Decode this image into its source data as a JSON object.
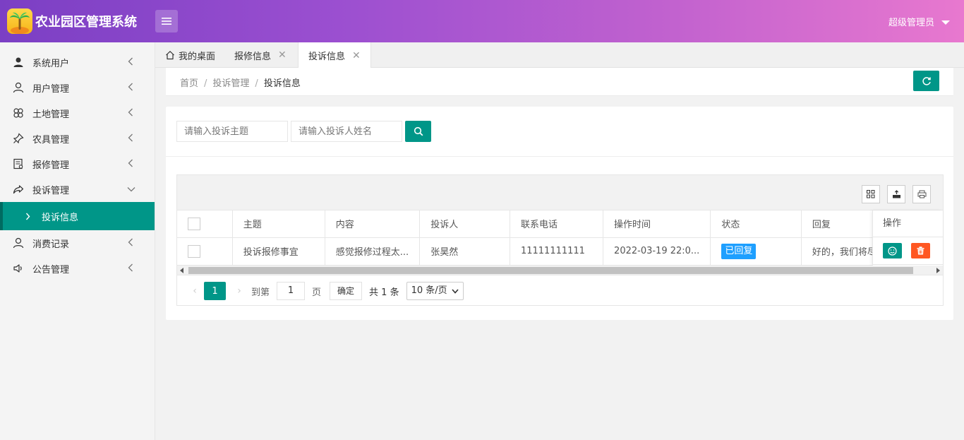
{
  "header": {
    "app_title": "农业园区管理系统",
    "user_name": "超级管理员"
  },
  "sidebar": {
    "items": [
      {
        "label": "系统用户",
        "icon": "user-filled-icon"
      },
      {
        "label": "用户管理",
        "icon": "user-outline-icon"
      },
      {
        "label": "土地管理",
        "icon": "clover-icon"
      },
      {
        "label": "农具管理",
        "icon": "pin-icon"
      },
      {
        "label": "报修管理",
        "icon": "form-icon"
      },
      {
        "label": "投诉管理",
        "icon": "share-icon"
      },
      {
        "label": "消费记录",
        "icon": "user-outline-icon"
      },
      {
        "label": "公告管理",
        "icon": "speaker-icon"
      }
    ],
    "sub_active": "投诉信息"
  },
  "tabs": [
    {
      "label": "我的桌面",
      "icon": "home-icon"
    },
    {
      "label": "报修信息"
    },
    {
      "label": "投诉信息",
      "active": true
    }
  ],
  "breadcrumb": {
    "home": "首页",
    "section": "投诉管理",
    "current": "投诉信息",
    "sep": "/"
  },
  "search": {
    "subject_placeholder": "请输入投诉主题",
    "name_placeholder": "请输入投诉人姓名"
  },
  "table": {
    "columns": [
      "主题",
      "内容",
      "投诉人",
      "联系电话",
      "操作时间",
      "状态",
      "回复"
    ],
    "op_column": "操作",
    "rows": [
      {
        "subject": "投诉报修事宜",
        "content": "感觉报修过程太...",
        "person": "张昊然",
        "phone": "11111111111",
        "time": "2022-03-19 22:0...",
        "status": "已回复",
        "reply": "好的，我们将尽..."
      }
    ]
  },
  "pager": {
    "current_page": "1",
    "goto_label": "到第",
    "goto_value": "1",
    "page_unit": "页",
    "confirm": "确定",
    "total": "共 1 条",
    "page_size": "10 条/页"
  },
  "colors": {
    "accent": "#009688",
    "danger": "#ff5722",
    "status_blue": "#1e9fff"
  }
}
